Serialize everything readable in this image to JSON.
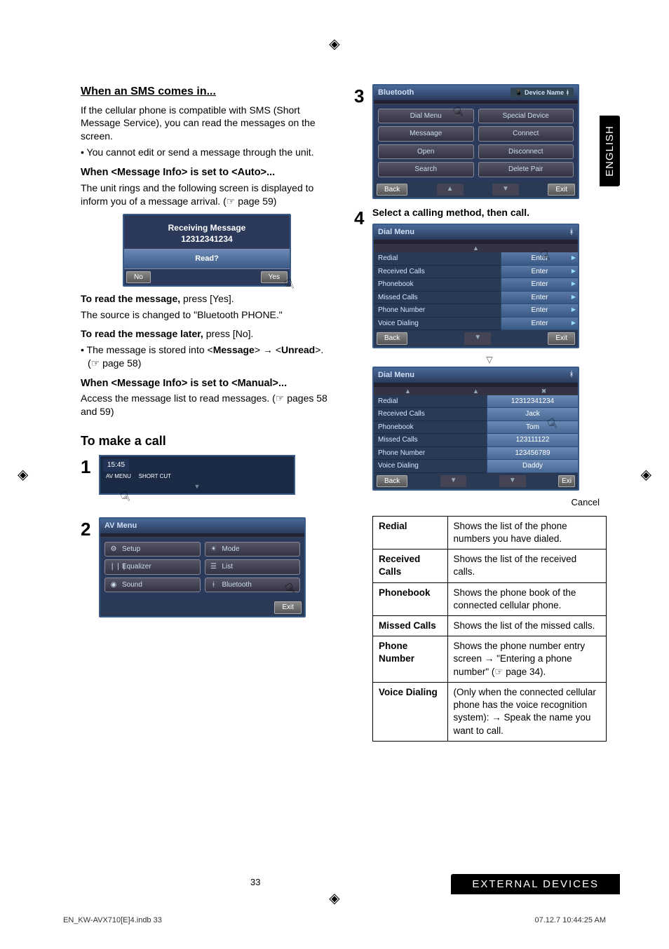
{
  "side_tab": "ENGLISH",
  "footer_bar": "EXTERNAL DEVICES",
  "page_number": "33",
  "print_footer_left": "EN_KW-AVX710[E]4.indb   33",
  "print_footer_right": "07.12.7   10:44:25 AM",
  "left": {
    "sms_heading": "When an SMS comes in...",
    "sms_intro": "If the cellular phone is compatible with SMS (Short Message Service), you can read the messages on the screen.",
    "sms_bullet": "You cannot edit or send a message through the unit.",
    "auto_heading": "When <Message Info> is set to <Auto>...",
    "auto_text_part1": "The unit rings and the following screen is displayed to inform you of a message arrival. (",
    "auto_text_ptr": "☞",
    "auto_text_part2": " page 59)",
    "recv_box": {
      "line1": "Receiving Message",
      "line2": "12312341234",
      "read": "Read?",
      "no": "No",
      "yes": "Yes"
    },
    "read_yes_label": "To read the message,",
    "read_yes_action": " press [Yes].",
    "read_yes_note": "The source is changed to \"Bluetooth PHONE.\"",
    "read_no_label": "To read the message later,",
    "read_no_action": " press [No].",
    "read_no_bullet_pre": "The message is stored into  <",
    "read_no_bullet_b1": "Message",
    "read_no_bullet_mid": "> → <",
    "read_no_bullet_b2": "Unread",
    "read_no_bullet_post": ">. (☞ page 58)",
    "manual_heading": "When <Message Info> is set to <Manual>...",
    "manual_text": "Access the message list to read messages. (☞ pages 58 and 59)",
    "call_heading": "To make a call",
    "clock": {
      "time": "15:45",
      "avmenu": "AV MENU",
      "short": "SHORT CUT"
    },
    "av_menu": {
      "title": "AV Menu",
      "left": [
        {
          "icon": "⚙",
          "label": "Setup"
        },
        {
          "icon": "❘❘❘",
          "label": "Equalizer"
        },
        {
          "icon": "◉",
          "label": "Sound"
        }
      ],
      "right": [
        {
          "icon": "☀",
          "label": "Mode"
        },
        {
          "icon": "☰",
          "label": "List"
        },
        {
          "icon": "ᚼ",
          "label": "Bluetooth"
        }
      ],
      "exit": "Exit"
    }
  },
  "right": {
    "bt_menu": {
      "title": "Bluetooth",
      "device": "Device Name",
      "left": [
        "Dial Menu",
        "Messaage",
        "Open",
        "Search"
      ],
      "right": [
        "Special Device",
        "Connect",
        "Disconnect",
        "Delete Pair"
      ],
      "back": "Back",
      "exit": "Exit"
    },
    "step4_text": "Select a calling method, then call.",
    "dial_menu_title": "Dial Menu",
    "dial_rows": [
      "Redial",
      "Received Calls",
      "Phonebook",
      "Missed Calls",
      "Phone Number",
      "Voice Dialing"
    ],
    "dial_enter": "Enter",
    "dial_back": "Back",
    "dial_exit": "Exit",
    "dial_values": [
      "12312341234",
      "Jack",
      "Tom",
      "123111122",
      "123456789",
      "Daddy"
    ],
    "cancel": "Cancel",
    "table": [
      {
        "term": "Redial",
        "desc": "Shows the list of the phone numbers you have dialed."
      },
      {
        "term": "Received Calls",
        "desc": "Shows the list of the received calls."
      },
      {
        "term": "Phonebook",
        "desc": "Shows the phone book of the connected cellular phone."
      },
      {
        "term": "Missed Calls",
        "desc": "Shows the list of the missed calls."
      },
      {
        "term": "Phone Number",
        "desc": " Shows the phone number entry screen → \"Entering a phone number\" (☞ page 34)."
      },
      {
        "term": "Voice Dialing",
        "desc": "(Only when the connected cellular phone has the voice recognition system): → Speak the name you want to call."
      }
    ]
  }
}
